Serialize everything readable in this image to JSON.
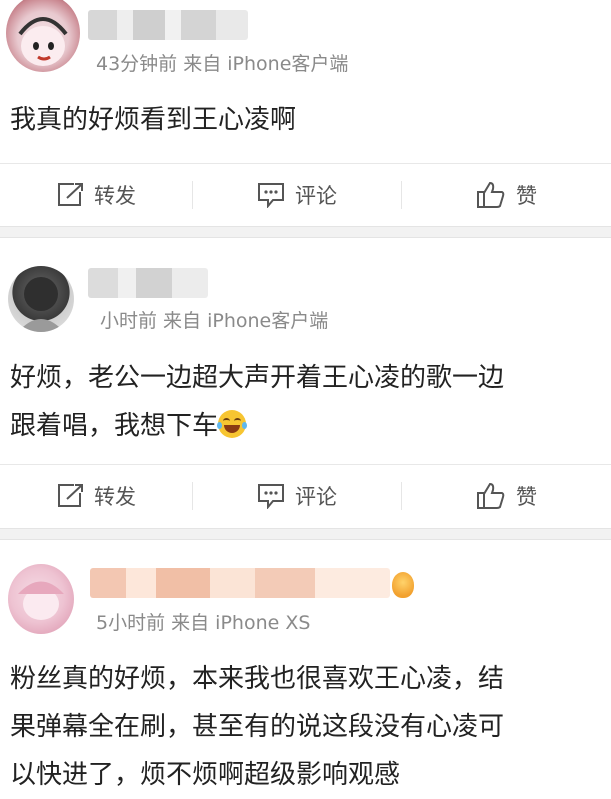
{
  "posts": [
    {
      "meta": "43分钟前 来自 iPhone客户端",
      "content": "我真的好烦看到王心凌啊",
      "actions": {
        "repost": "转发",
        "comment": "评论",
        "like": "赞"
      }
    },
    {
      "meta": "小时前 来自 iPhone客户端",
      "content_line1": "好烦，老公一边超大声开着王心凌的歌一边",
      "content_line2": "跟着唱，我想下车",
      "actions": {
        "repost": "转发",
        "comment": "评论",
        "like": "赞"
      }
    },
    {
      "meta": "5小时前 来自 iPhone XS",
      "content_line1": "粉丝真的好烦，本来我也很喜欢王心凌，结",
      "content_line2": "果弹幕全在刷，甚至有的说这段没有心凌可",
      "content_line3": "以快进了，烦不烦啊超级影响观感"
    }
  ],
  "colors": {
    "meta": "#8a8a8a",
    "separator": "#f2f2f2",
    "icon": "#555555"
  },
  "icons": {
    "repost": "repost-icon",
    "comment": "comment-icon",
    "like": "thumbs-up-icon",
    "emoji": "laughing-tears-emoji",
    "badge": "member-badge-icon"
  }
}
